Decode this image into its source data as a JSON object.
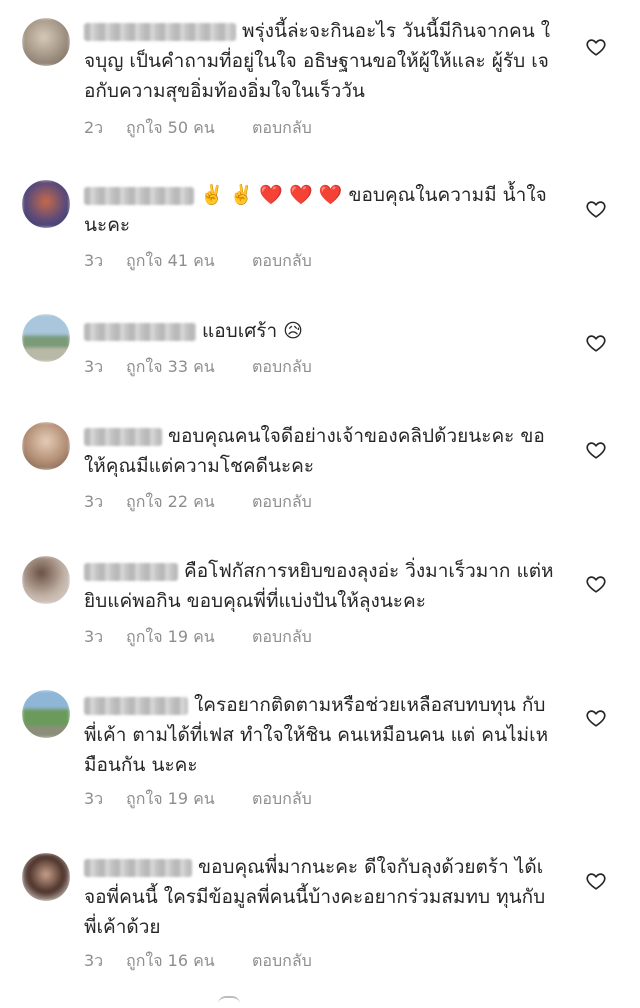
{
  "comments": [
    {
      "text": "พรุ่งนี้ล่ะจะกินอะไร วันนี้มีกินจากคน ใจบุญ เป็นคำถามที่อยู่ในใจ อธิษฐานขอให้ผู้ให้และ ผู้รับ เจอกับความสุขอิ่มท้องอิ่มใจในเร็ววัน",
      "age": "2ว",
      "likes": "ถูกใจ 50 คน",
      "reply": "ตอบกลับ"
    },
    {
      "text": "✌️ ✌️ ❤️ ❤️ ❤️ ขอบคุณในความมี น้ำใจนะคะ",
      "age": "3ว",
      "likes": "ถูกใจ 41 คน",
      "reply": "ตอบกลับ"
    },
    {
      "text": "แอบเศร้า 😥",
      "age": "3ว",
      "likes": "ถูกใจ 33 คน",
      "reply": "ตอบกลับ"
    },
    {
      "text": "ขอบคุณคนใจดีอย่างเจ้าของคลิปด้วยนะคะ ขอให้คุณมีแต่ความโชคดีนะคะ",
      "age": "3ว",
      "likes": "ถูกใจ 22 คน",
      "reply": "ตอบกลับ"
    },
    {
      "text": "คือโฟกัสการหยิบของลุงอ่ะ วิ่งมาเร็วมาก แต่หยิบแค่พอกิน ขอบคุณพี่ที่แบ่งปันให้ลุงนะคะ",
      "age": "3ว",
      "likes": "ถูกใจ 19 คน",
      "reply": "ตอบกลับ"
    },
    {
      "text": "ใครอยากติดตามหรือช่วยเหลือสบทบทุน กับพี่เค้า ตามได้ที่เฟส ทำใจให้ชิน คนเหมือนคน แต่ คนไม่เหมือนกัน นะคะ",
      "age": "3ว",
      "likes": "ถูกใจ 19 คน",
      "reply": "ตอบกลับ"
    },
    {
      "text": "ขอบคุณพี่มากนะคะ ดีใจกับลุงด้วยตร้า ได้เจอพี่คนนี้ ใครมีข้อมูลพี่คนนี้บ้างคะอยากร่วมสมทบ ทุนกับพี่เค้าด้วย",
      "age": "3ว",
      "likes": "ถูกใจ 16 คน",
      "reply": "ตอบกลับ"
    }
  ],
  "icons": {
    "like": "heart-outline-icon",
    "avatar": "blurred-profile-photo"
  },
  "colors": {
    "text": "#262626",
    "meta": "#8e8e8e",
    "icon": "#262626"
  }
}
